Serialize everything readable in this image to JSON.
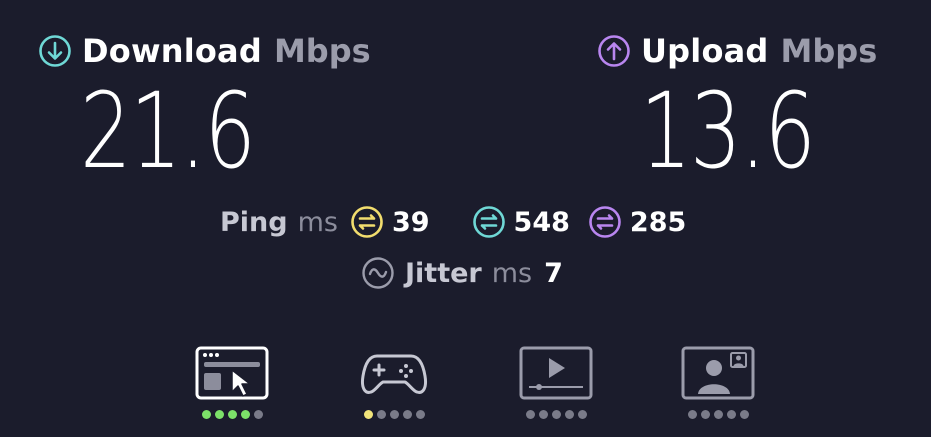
{
  "download": {
    "title": "Download",
    "unit": "Mbps",
    "value": "21.6",
    "icon": "arrow-down-circle-icon",
    "color": "#6fd8d6"
  },
  "upload": {
    "title": "Upload",
    "unit": "Mbps",
    "value": "13.6",
    "icon": "arrow-up-circle-icon",
    "color": "#b986f0"
  },
  "ping": {
    "label": "Ping",
    "unit": "ms",
    "idle": {
      "value": "39",
      "color": "#f2dd6e"
    },
    "download": {
      "value": "548",
      "color": "#6fd8d6"
    },
    "upload": {
      "value": "285",
      "color": "#b986f0"
    }
  },
  "jitter": {
    "label": "Jitter",
    "unit": "ms",
    "value": "7"
  },
  "usecases": [
    {
      "icon": "web-browsing-icon",
      "rating": 4,
      "max": 5,
      "color": "#7ce069"
    },
    {
      "icon": "gaming-controller-icon",
      "rating": 1,
      "max": 5,
      "color": "#f1e37a"
    },
    {
      "icon": "video-streaming-icon",
      "rating": 0,
      "max": 5,
      "color": "#7a7b89"
    },
    {
      "icon": "video-chat-icon",
      "rating": 0,
      "max": 5,
      "color": "#7a7b89"
    }
  ]
}
